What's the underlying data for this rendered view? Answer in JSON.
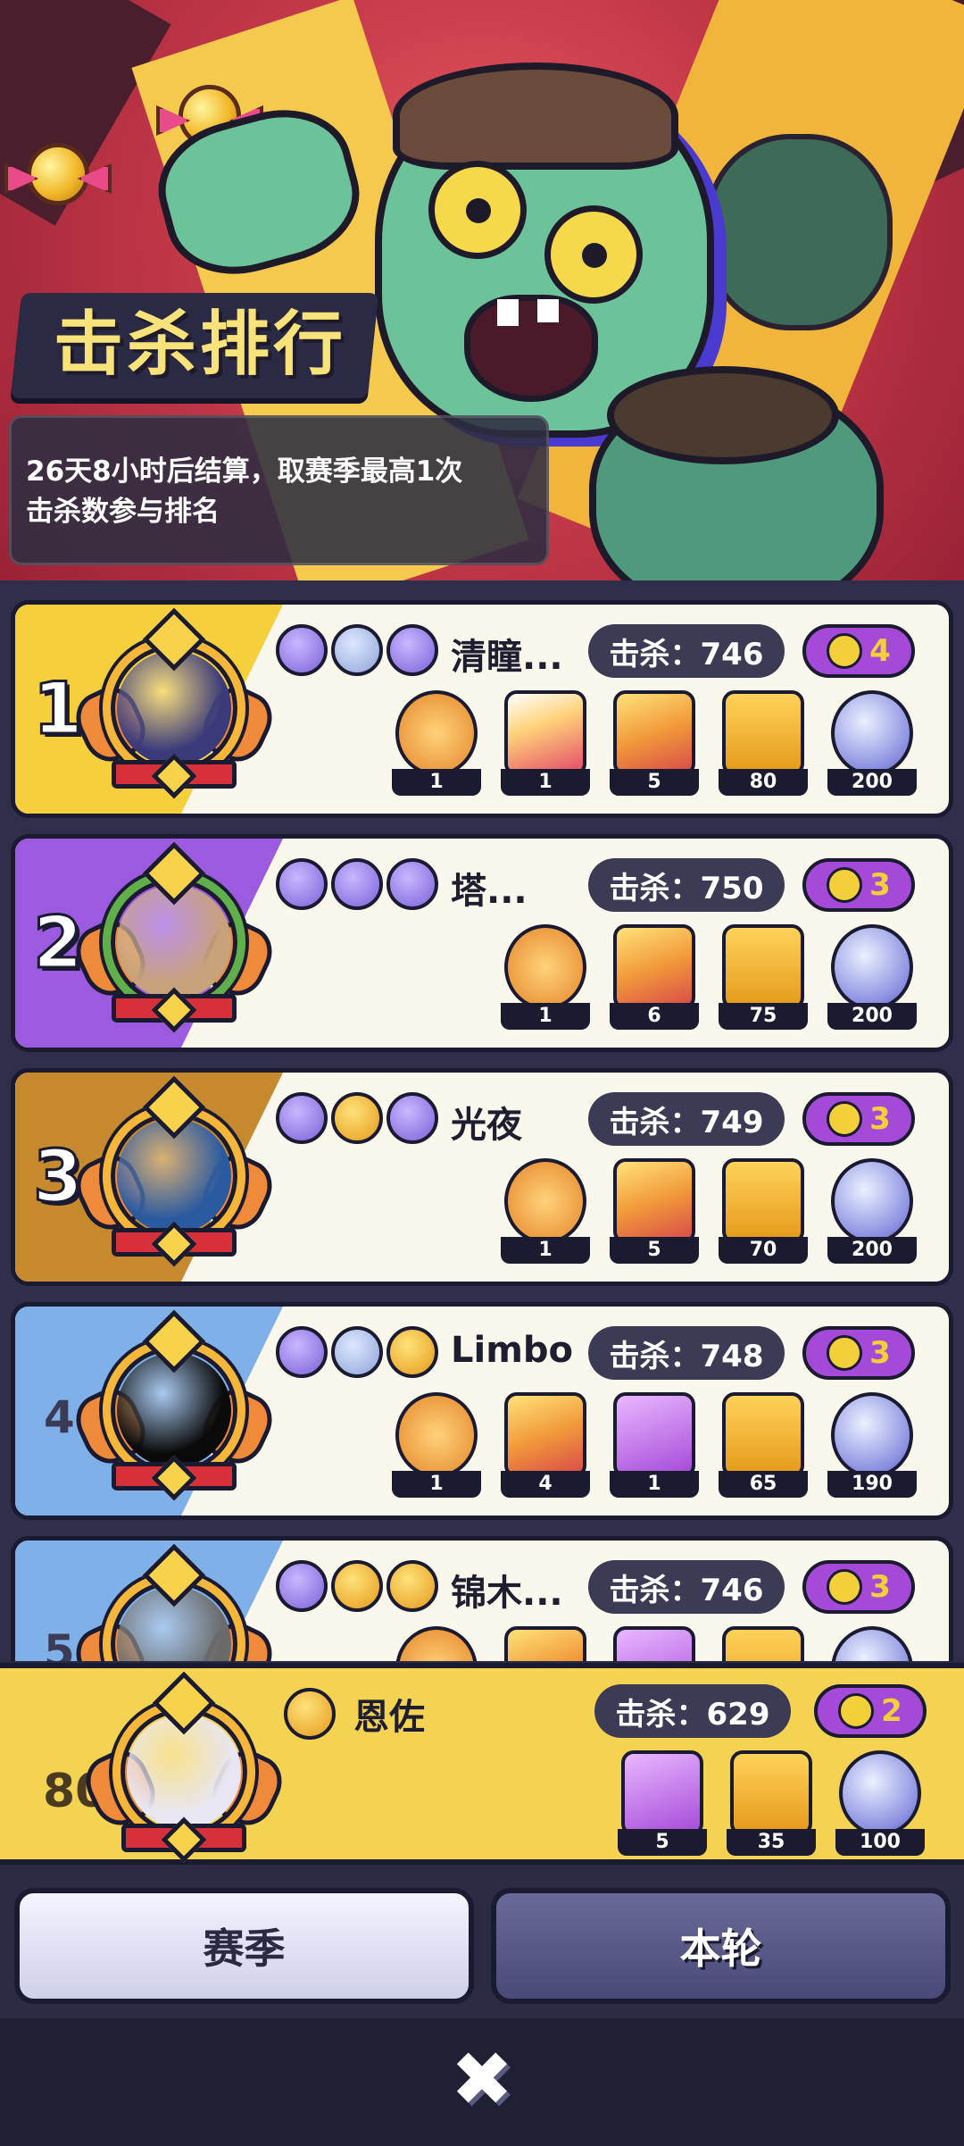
{
  "header": {
    "title": "击杀排行",
    "info_line1": "26天8小时后结算，取赛季最高1次",
    "info_line2": "击杀数参与排名"
  },
  "ranking": [
    {
      "rank": "1",
      "name": "清瞳...",
      "kills": "击杀：746",
      "score": "4",
      "stripe_color": "#f6cf3c",
      "avatar_color": "#3a3a7a",
      "ring_color": "#f5b63a",
      "badges": [
        "b-purple",
        "b-blue",
        "b-purple"
      ],
      "rewards": [
        {
          "icon": "ic-frame",
          "count": "1"
        },
        {
          "icon": "ic-card1",
          "count": "1"
        },
        {
          "icon": "ic-card2",
          "count": "5"
        },
        {
          "icon": "ic-ticket",
          "count": "80"
        },
        {
          "icon": "ic-orb",
          "count": "200"
        }
      ]
    },
    {
      "rank": "2",
      "name": "塔...",
      "kills": "击杀：750",
      "score": "3",
      "stripe_color": "#9b5ae0",
      "avatar_color": "#c8a27a",
      "ring_color": "#5fb04a",
      "badges": [
        "b-purple",
        "b-purple",
        "b-purple"
      ],
      "rewards": [
        {
          "icon": "ic-frame",
          "count": "1"
        },
        {
          "icon": "ic-card2",
          "count": "6"
        },
        {
          "icon": "ic-ticket",
          "count": "75"
        },
        {
          "icon": "ic-orb",
          "count": "200"
        }
      ]
    },
    {
      "rank": "3",
      "name": "光夜",
      "kills": "击杀：749",
      "score": "3",
      "stripe_color": "#c7892e",
      "avatar_color": "#2a5aa0",
      "ring_color": "#f5b63a",
      "badges": [
        "b-purple",
        "b-gold",
        "b-purple"
      ],
      "rewards": [
        {
          "icon": "ic-frame",
          "count": "1"
        },
        {
          "icon": "ic-card2",
          "count": "5"
        },
        {
          "icon": "ic-ticket",
          "count": "70"
        },
        {
          "icon": "ic-orb",
          "count": "200"
        }
      ]
    },
    {
      "rank": "4",
      "name": "Limbo",
      "kills": "击杀：748",
      "score": "3",
      "stripe_color": "#7fb0ea",
      "avatar_color": "#0a0a0a",
      "ring_color": "#f5b63a",
      "badges": [
        "b-purple",
        "b-blue",
        "b-gold"
      ],
      "rewards": [
        {
          "icon": "ic-frame",
          "count": "1"
        },
        {
          "icon": "ic-card2",
          "count": "4"
        },
        {
          "icon": "ic-card3",
          "count": "1"
        },
        {
          "icon": "ic-ticket",
          "count": "65"
        },
        {
          "icon": "ic-orb",
          "count": "190"
        }
      ]
    },
    {
      "rank": "5",
      "name": "锦木...",
      "kills": "击杀：746",
      "score": "3",
      "stripe_color": "#7fb0ea",
      "avatar_color": "#6a6a6a",
      "ring_color": "#f5b63a",
      "badges": [
        "b-purple",
        "b-gold",
        "b-gold"
      ],
      "rewards": [
        {
          "icon": "ic-frame",
          "count": ""
        },
        {
          "icon": "ic-card2",
          "count": ""
        },
        {
          "icon": "ic-card3",
          "count": ""
        },
        {
          "icon": "ic-ticket",
          "count": ""
        },
        {
          "icon": "ic-orb",
          "count": ""
        }
      ]
    }
  ],
  "self": {
    "rank": "80",
    "name": "恩佐",
    "kills": "击杀：629",
    "score": "2",
    "avatar_color": "#e8e6f2",
    "rewards": [
      {
        "icon": "ic-card3",
        "count": "5"
      },
      {
        "icon": "ic-ticket",
        "count": "35"
      },
      {
        "icon": "ic-orb",
        "count": "100"
      }
    ]
  },
  "tabs": {
    "season": "赛季",
    "round": "本轮"
  },
  "close_icon": "✖"
}
